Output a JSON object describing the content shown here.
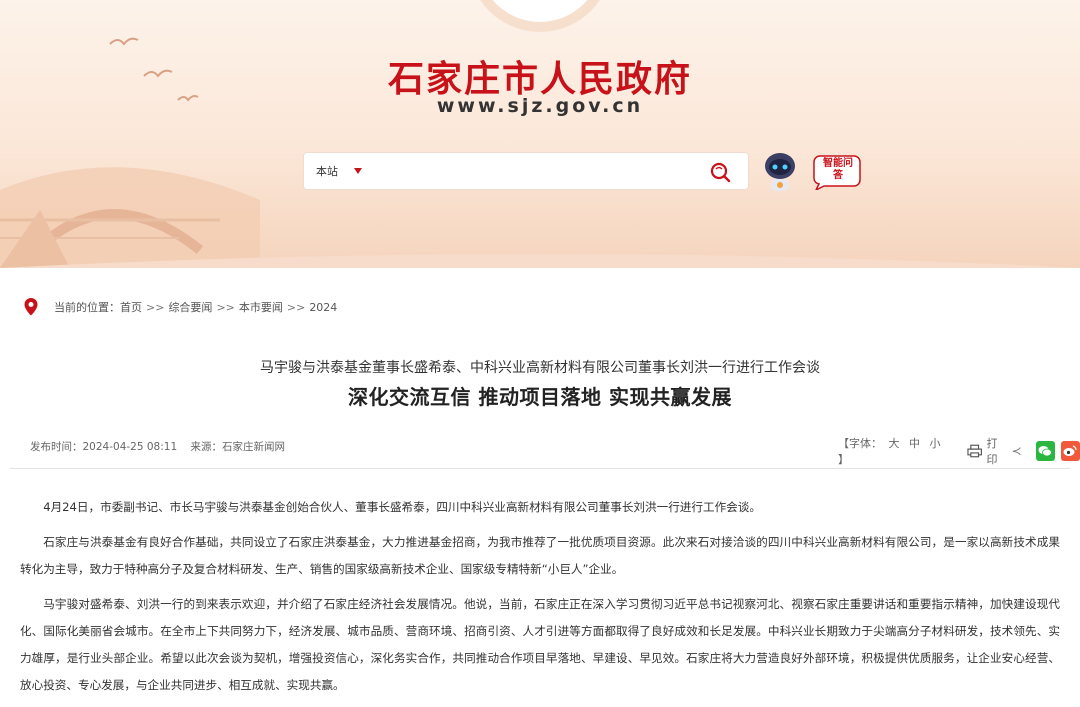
{
  "header": {
    "site_title": "石家庄市人民政府",
    "site_url": "www.sjz.gov.cn",
    "search": {
      "scope": "本站",
      "placeholder": ""
    },
    "assistant_label": "智能问答",
    "colors": {
      "brand_red": "#c8121a",
      "banner_bg": "#fbe7d8"
    }
  },
  "breadcrumb": {
    "prefix": "当前的位置：",
    "items": [
      "首页",
      "综合要闻",
      "本市要闻",
      "2024"
    ],
    "separator": ">>"
  },
  "article": {
    "subtitle": "马宇骏与洪泰基金董事长盛希泰、中科兴业高新材料有限公司董事长刘洪一行进行工作会谈",
    "headline": "深化交流互信 推动项目落地 实现共赢发展",
    "publish_label": "发布时间：",
    "publish_time": "2024-04-25 08:11",
    "source_label": "来源：",
    "source": "石家庄新闻网",
    "font_size_label": "【字体：",
    "font_sizes": [
      "大",
      "中",
      "小"
    ],
    "font_size_close": "】",
    "print_label": "打印",
    "paragraphs": [
      "4月24日，市委副书记、市长马宇骏与洪泰基金创始合伙人、董事长盛希泰，四川中科兴业高新材料有限公司董事长刘洪一行进行工作会谈。",
      "石家庄与洪泰基金有良好合作基础，共同设立了石家庄洪泰基金，大力推进基金招商，为我市推荐了一批优质项目资源。此次来石对接洽谈的四川中科兴业高新材料有限公司，是一家以高新技术成果转化为主导，致力于特种高分子及复合材料研发、生产、销售的国家级高新技术企业、国家级专精特新“小巨人”企业。",
      "马宇骏对盛希泰、刘洪一行的到来表示欢迎，并介绍了石家庄经济社会发展情况。他说，当前，石家庄正在深入学习贯彻习近平总书记视察河北、视察石家庄重要讲话和重要指示精神，加快建设现代化、国际化美丽省会城市。在全市上下共同努力下，经济发展、城市品质、营商环境、招商引资、人才引进等方面都取得了良好成效和长足发展。中科兴业长期致力于尖端高分子材料研发，技术领先、实力雄厚，是行业头部企业。希望以此次会谈为契机，增强投资信心，深化务实合作，共同推动合作项目早落地、早建设、早见效。石家庄将大力营造良好外部环境，积极提供优质服务，让企业安心经营、放心投资、专心发展，与企业共同进步、相互成就、实现共赢。"
    ]
  }
}
